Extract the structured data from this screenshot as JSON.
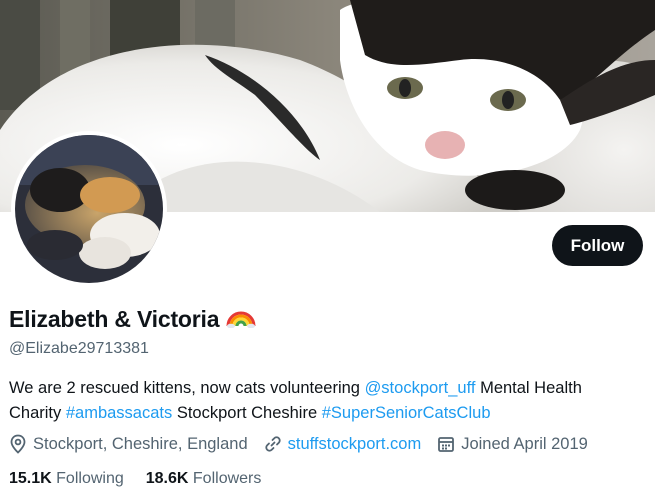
{
  "profile": {
    "display_name": "Elizabeth & Victoria",
    "name_emoji": "rainbow-emoji",
    "handle": "@Elizabe29713381",
    "follow_label": "Follow",
    "bio": {
      "line1_text": "We are 2 rescued kittens, now cats volunteering ",
      "line1_mention": "@stockport_uff",
      "line1_tail": " Mental Health",
      "line2_prefix": "Charity ",
      "line2_hashtag1": "#ambassacats",
      "line2_middle": " Stockport Cheshire ",
      "line2_hashtag2": "#SuperSeniorCatsClub"
    },
    "location": "Stockport, Cheshire, England",
    "website": "stuffstockport.com",
    "joined": "Joined April 2019",
    "following_count": "15.1K",
    "following_label": "Following",
    "followers_count": "18.6K",
    "followers_label": "Followers"
  },
  "icons": {
    "location": "location-pin-icon",
    "website": "link-icon",
    "joined": "calendar-icon"
  },
  "colors": {
    "accent": "#1d9bf0",
    "text_primary": "#0f1419",
    "text_secondary": "#536471",
    "button_bg": "#0f1419"
  }
}
